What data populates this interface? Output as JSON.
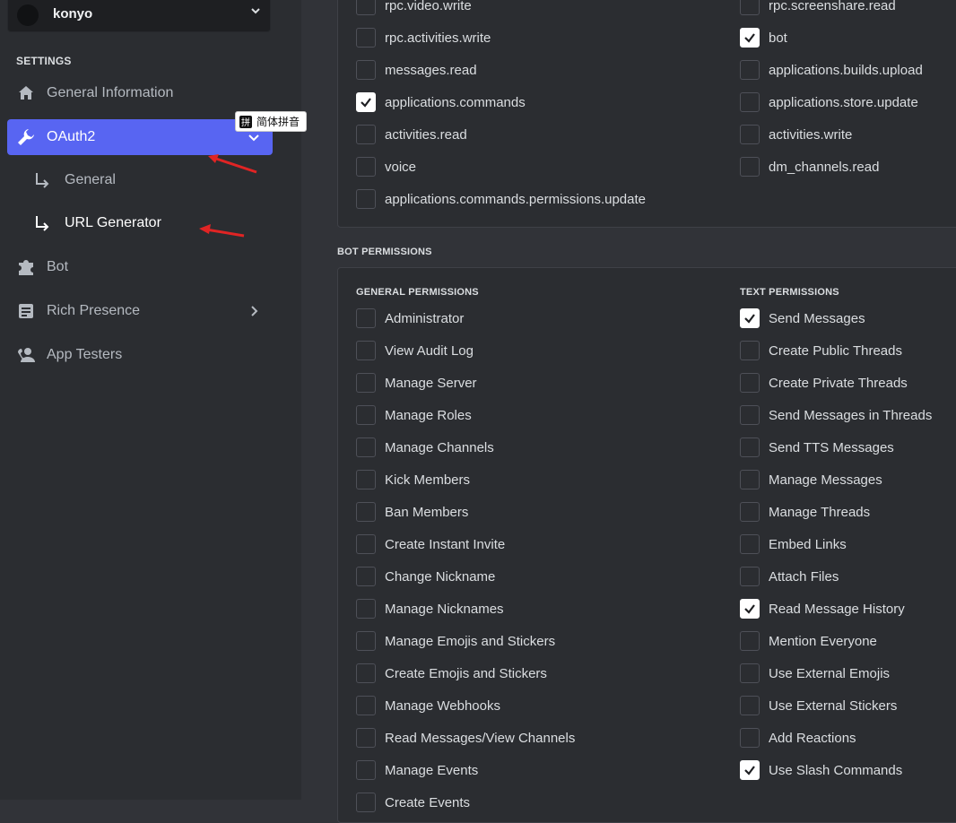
{
  "app": {
    "name": "konyo"
  },
  "sidebar": {
    "section_title": "SETTINGS",
    "items": [
      {
        "label": "General Information",
        "icon": "home-icon"
      },
      {
        "label": "OAuth2",
        "icon": "wrench-icon",
        "active": true
      },
      {
        "label": "Bot",
        "icon": "puzzle-icon"
      },
      {
        "label": "Rich Presence",
        "icon": "document-icon"
      },
      {
        "label": "App Testers",
        "icon": "person-icon"
      }
    ],
    "subitems": [
      {
        "label": "General"
      },
      {
        "label": "URL Generator"
      }
    ]
  },
  "ime": {
    "badge": "拼",
    "label": "简体拼音"
  },
  "scopes": {
    "left": [
      {
        "label": "rpc.video.write",
        "checked": false
      },
      {
        "label": "rpc.activities.write",
        "checked": false
      },
      {
        "label": "messages.read",
        "checked": false
      },
      {
        "label": "applications.commands",
        "checked": true
      },
      {
        "label": "activities.read",
        "checked": false
      },
      {
        "label": "voice",
        "checked": false
      },
      {
        "label": "applications.commands.permissions.update",
        "checked": false
      }
    ],
    "right": [
      {
        "label": "rpc.screenshare.read",
        "checked": false
      },
      {
        "label": "bot",
        "checked": true
      },
      {
        "label": "applications.builds.upload",
        "checked": false
      },
      {
        "label": "applications.store.update",
        "checked": false
      },
      {
        "label": "activities.write",
        "checked": false
      },
      {
        "label": "dm_channels.read",
        "checked": false
      }
    ]
  },
  "bot_permissions": {
    "heading": "BOT PERMISSIONS",
    "general_title": "GENERAL PERMISSIONS",
    "text_title": "TEXT PERMISSIONS",
    "general": [
      {
        "label": "Administrator",
        "checked": false
      },
      {
        "label": "View Audit Log",
        "checked": false
      },
      {
        "label": "Manage Server",
        "checked": false
      },
      {
        "label": "Manage Roles",
        "checked": false
      },
      {
        "label": "Manage Channels",
        "checked": false
      },
      {
        "label": "Kick Members",
        "checked": false
      },
      {
        "label": "Ban Members",
        "checked": false
      },
      {
        "label": "Create Instant Invite",
        "checked": false
      },
      {
        "label": "Change Nickname",
        "checked": false
      },
      {
        "label": "Manage Nicknames",
        "checked": false
      },
      {
        "label": "Manage Emojis and Stickers",
        "checked": false
      },
      {
        "label": "Create Emojis and Stickers",
        "checked": false
      },
      {
        "label": "Manage Webhooks",
        "checked": false
      },
      {
        "label": "Read Messages/View Channels",
        "checked": false
      },
      {
        "label": "Manage Events",
        "checked": false
      },
      {
        "label": "Create Events",
        "checked": false
      }
    ],
    "text": [
      {
        "label": "Send Messages",
        "checked": true
      },
      {
        "label": "Create Public Threads",
        "checked": false
      },
      {
        "label": "Create Private Threads",
        "checked": false
      },
      {
        "label": "Send Messages in Threads",
        "checked": false
      },
      {
        "label": "Send TTS Messages",
        "checked": false
      },
      {
        "label": "Manage Messages",
        "checked": false
      },
      {
        "label": "Manage Threads",
        "checked": false
      },
      {
        "label": "Embed Links",
        "checked": false
      },
      {
        "label": "Attach Files",
        "checked": false
      },
      {
        "label": "Read Message History",
        "checked": true
      },
      {
        "label": "Mention Everyone",
        "checked": false
      },
      {
        "label": "Use External Emojis",
        "checked": false
      },
      {
        "label": "Use External Stickers",
        "checked": false
      },
      {
        "label": "Add Reactions",
        "checked": false
      },
      {
        "label": "Use Slash Commands",
        "checked": true
      }
    ]
  },
  "colors": {
    "accent": "#5865f2",
    "annotation": "#e02424"
  }
}
